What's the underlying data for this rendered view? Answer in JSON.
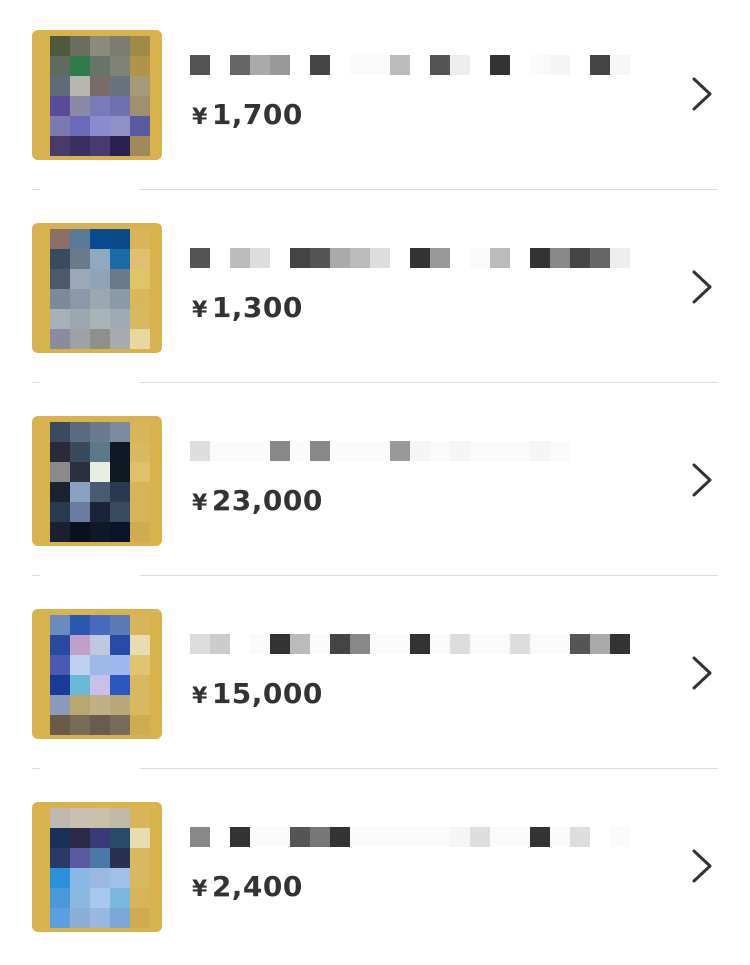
{
  "items": [
    {
      "price_symbol": "¥",
      "price": "1,700"
    },
    {
      "price_symbol": "¥",
      "price": "1,300"
    },
    {
      "price_symbol": "¥",
      "price": "23,000"
    },
    {
      "price_symbol": "¥",
      "price": "15,000"
    },
    {
      "price_symbol": "¥",
      "price": "2,400"
    }
  ],
  "icons": {
    "chevron": "chevron-right-icon"
  },
  "colors": {
    "price_text": "#333333",
    "divider": "#dcdcdc",
    "thumb_frame": "#d8b24d"
  }
}
